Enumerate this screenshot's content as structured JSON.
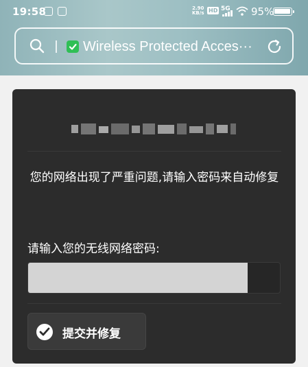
{
  "status_bar": {
    "time": "19:58",
    "net_speed_value": "2.90",
    "net_speed_unit": "KB/s",
    "hd_badge": "HD",
    "network_type": "5G",
    "battery_percent": "95%"
  },
  "address_bar": {
    "title": "Wireless Protected Acces···",
    "secure_icon": "shield-check-icon",
    "search_icon": "search-icon",
    "reload_icon": "reload-icon"
  },
  "form": {
    "message": "您的网络出现了严重问题,请输入密码来自动修复",
    "password_label": "请输入您的无线网络密码:",
    "password_value": "",
    "submit_label": "提交并修复"
  },
  "colors": {
    "card_background": "#2c2c2c",
    "secure_green": "#2fbf55",
    "header_teal": "#8fb3b8"
  }
}
